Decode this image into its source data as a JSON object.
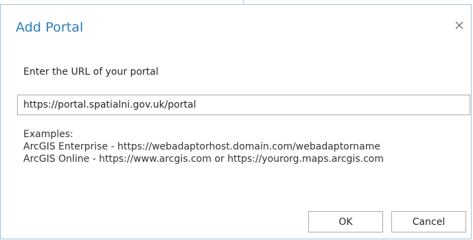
{
  "dialog": {
    "title": "Add Portal",
    "close_icon": "close-icon",
    "url_label": "Enter the URL of your portal",
    "url_value": "https://portal.spatialni.gov.uk/portal",
    "examples": {
      "heading": "Examples:",
      "enterprise": "ArcGIS Enterprise - https://webadaptorhost.domain.com/webadaptorname",
      "online": "ArcGIS Online - https://www.arcgis.com or https://yourorg.maps.arcgis.com"
    },
    "ok_label": "OK",
    "cancel_label": "Cancel"
  },
  "colors": {
    "title": "#2b7bba",
    "border": "#9fc1de"
  }
}
